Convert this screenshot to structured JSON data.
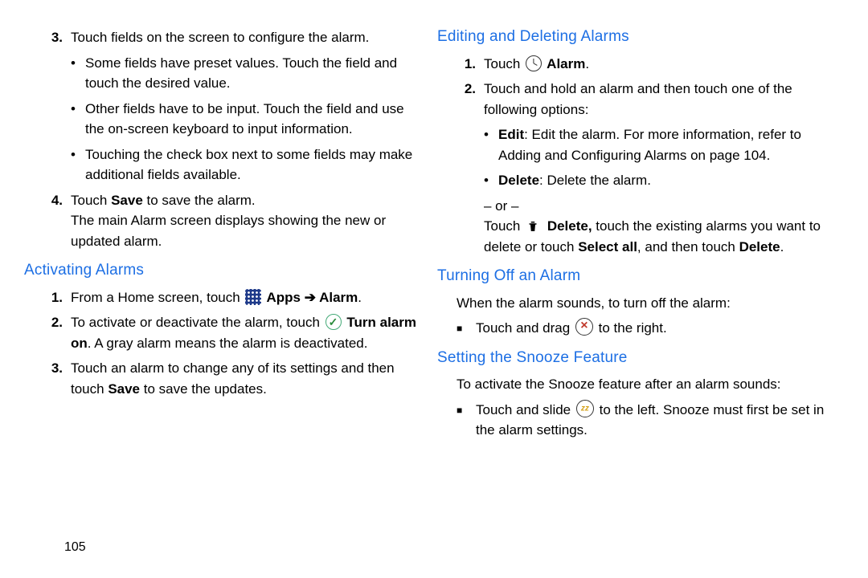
{
  "page_number": "105",
  "left": {
    "step3": {
      "num": "3.",
      "text": "Touch fields on the screen to configure the alarm.",
      "b1": "Some fields have preset values. Touch the field and touch the desired value.",
      "b2": "Other fields have to be input. Touch the field and use the on-screen keyboard to input information.",
      "b3": "Touching the check box next to some fields may make additional fields available."
    },
    "step4": {
      "num": "4.",
      "t1a": "Touch ",
      "t1b": "Save",
      "t1c": " to save the alarm.",
      "t2": "The main Alarm screen displays showing the new or updated alarm."
    },
    "h_activating": "Activating Alarms",
    "act1": {
      "num": "1.",
      "a": "From a Home screen, touch ",
      "apps": " Apps",
      "arrow": " ➔ ",
      "alarm": "Alarm",
      "dot": "."
    },
    "act2": {
      "num": "2.",
      "a": "To activate or deactivate the alarm, touch ",
      "turn": " Turn alarm on",
      "b": ". A gray alarm means the alarm is deactivated."
    },
    "act3": {
      "num": "3.",
      "a": "Touch an alarm to change any of its settings and then touch ",
      "save": "Save",
      "b": " to save the updates."
    }
  },
  "right": {
    "h_edit": "Editing and Deleting Alarms",
    "e1": {
      "num": "1.",
      "a": "Touch ",
      "alarm": " Alarm",
      "dot": "."
    },
    "e2": {
      "num": "2.",
      "a": "Touch and hold an alarm and then touch one of the following options:",
      "b1a": "Edit",
      "b1b": ": Edit the alarm. For more information, refer to ",
      "b1c": "Adding and Configuring Alarms",
      "b1d": " on page 104.",
      "b2a": "Delete",
      "b2b": ": Delete the alarm.",
      "or": "– or –",
      "c1": "Touch ",
      "c2": " Delete,",
      "c3": " touch the existing alarms you want to delete or touch ",
      "c4": "Select all",
      "c5": ", and then touch ",
      "c6": "Delete",
      "c7": "."
    },
    "h_off": "Turning Off an Alarm",
    "off_intro": "When the alarm sounds, to turn off the alarm:",
    "off_b": {
      "a": "Touch and drag ",
      "b": " to the right."
    },
    "h_snooze": "Setting the Snooze Feature",
    "sn_intro": "To activate the Snooze feature after an alarm sounds:",
    "sn_b": {
      "a": "Touch and slide ",
      "b": " to the left. Snooze must first be set in the alarm settings."
    }
  }
}
